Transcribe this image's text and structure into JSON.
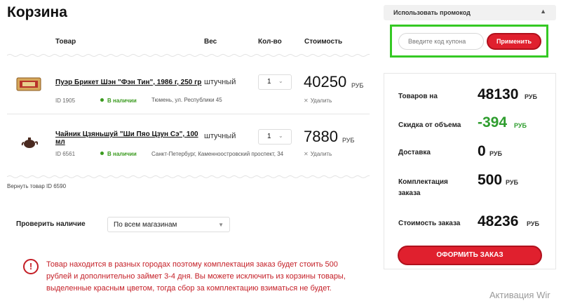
{
  "page": {
    "title": "Корзина"
  },
  "table": {
    "headers": {
      "product": "Товар",
      "weight": "Вес",
      "qty": "Кол-во",
      "cost": "Стоимость"
    }
  },
  "items": [
    {
      "name": "Пуэр Брикет Шэн \"Фэн Тин\", 1986 г, 250 гр",
      "unit": "штучный",
      "qty": "1",
      "price": "40250",
      "currency": "РУБ",
      "id": "ID 1905",
      "availability": "В наличии",
      "address": "Тюмень, ул. Республики 45",
      "delete_label": "Удалить"
    },
    {
      "name": "Чайник Цзяньшуй \"Ши Пяо Цзун Сэ\", 100 мл",
      "unit": "штучный",
      "qty": "1",
      "price": "7880",
      "currency": "РУБ",
      "id": "ID 6561",
      "availability": "В наличии",
      "address": "Санкт-Петербург, Каменноостровский проспект, 34",
      "delete_label": "Удалить"
    }
  ],
  "return_link": "Вернуть товар ID 6590",
  "availability_check": {
    "label": "Проверить наличие",
    "selected": "По всем магазинам"
  },
  "warning": {
    "icon": "!",
    "text": "Товар находится в разных городах поэтому комплектация заказ будет стоить 500 рублей и дополнительно займет 3-4 дня. Вы можете исключить из корзины товары, выделенные красным цветом, тогда сбор за комплектацию взиматься не будет."
  },
  "promo": {
    "header": "Использовать промокод",
    "placeholder": "Введите код купона",
    "apply_label": "Применить"
  },
  "summary": {
    "goods_label": "Товаров на",
    "goods_value": "48130",
    "goods_currency": "РУБ",
    "discount_label": "Скидка от объема",
    "discount_value": "-394",
    "discount_currency": "РУБ",
    "delivery_label": "Доставка",
    "delivery_value": "0",
    "delivery_currency": "РУБ",
    "assembly_label": "Комплектация заказа",
    "assembly_value": "500",
    "assembly_currency": "РУБ",
    "total_label": "Стоимость заказа",
    "total_value": "48236",
    "total_currency": "РУБ",
    "order_button": "ОФОРМИТЬ ЗАКАЗ"
  },
  "watermark": "Активация Wir",
  "colors": {
    "accent": "#e0202e",
    "highlight_border": "#35c924",
    "in_stock": "#3a9a1e",
    "discount": "#2e9d2e",
    "warning": "#c41e26"
  },
  "icons": {
    "collapse": "chevron-up-icon",
    "dropdown": "chevron-down-icon",
    "delete": "close-icon",
    "alert": "exclamation-circle-icon"
  }
}
